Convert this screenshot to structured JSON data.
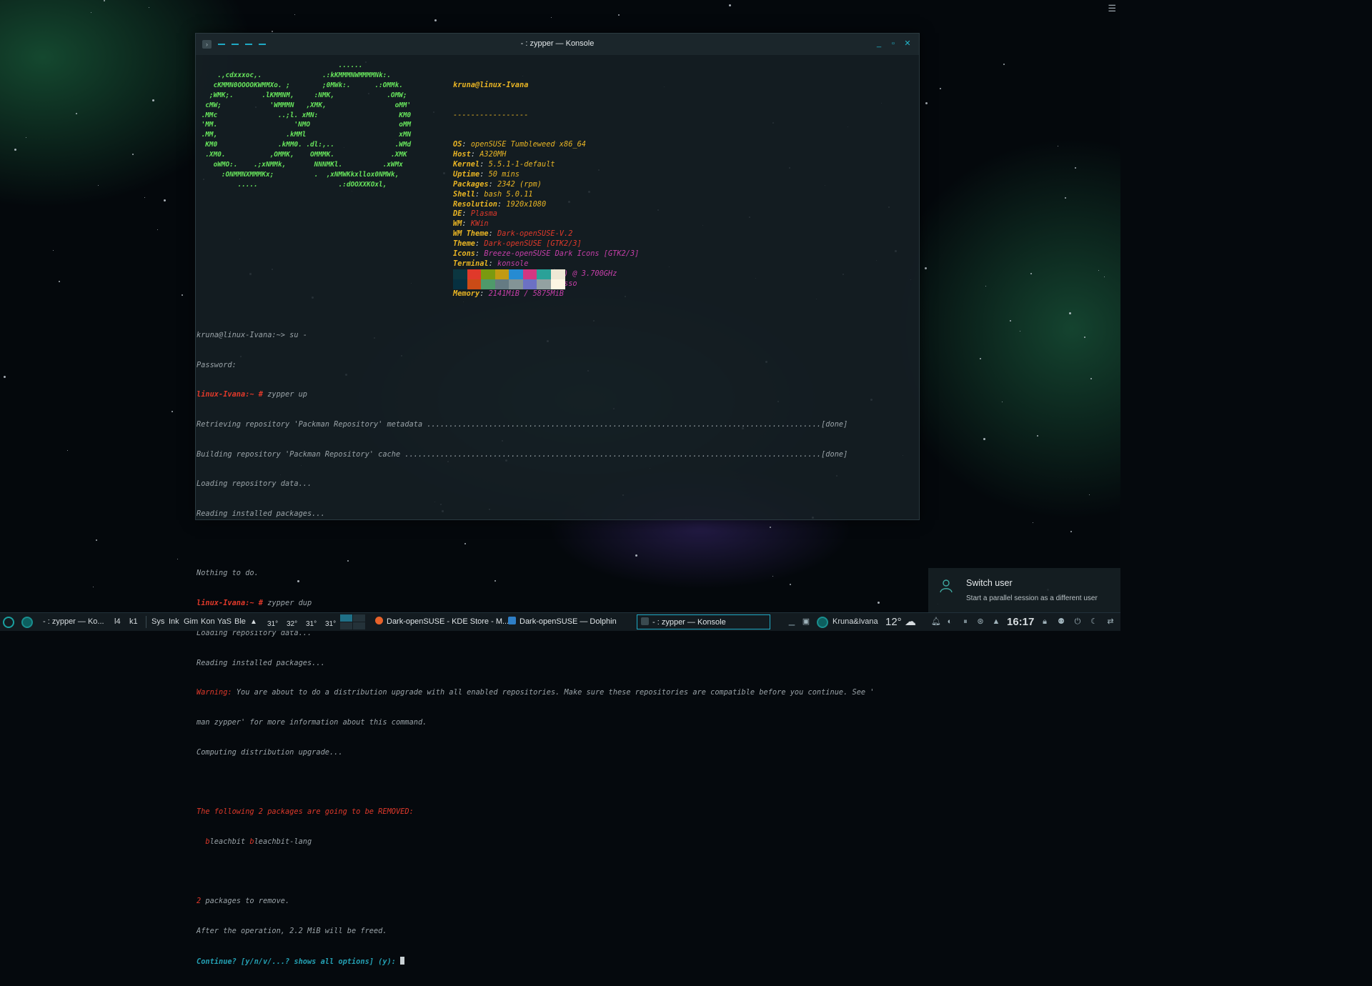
{
  "desktop": {
    "corner_menu_icon": "hamburger-icon"
  },
  "window": {
    "title": "- : zypper — Konsole",
    "buttons": {
      "minimize": "_",
      "maximize": "▫",
      "close": "✕"
    }
  },
  "neofetch": {
    "ascii_art": "                                   ......\n     .,cdxxxoc,.               .:kKMMMNWMMMMNk:.\n    cKMMN0OOOOKWMMXo. ;        ;0MWk:.      .:OMMk.\n   ;WMK;.       .lKMMNM,     :NMK,             .OMW;\n  cMW;            'WMMMN   ,XMK,                 oMM'\n .MMc               ..;l. xMN:                    KM0\n 'MM.                   'NMO                      oMM\n .MM,                 .kMMl                       xMN\n  KM0               .kMM0. .dl:,..               .WMd\n  .XM0.           ,OMMK,    OMMMK.              .XMK\n    oWMO:.    .;xNMMk,       NNNMKl.          .xWMx\n      :ONMMNXMMMKx;          .  ,xNMWKkxllox0NMWk,\n          .....                    .:dOOXXKOxl,",
    "user": "kruna@linux-Ivana",
    "separator": "-----------------",
    "info": [
      {
        "key": "OS",
        "value": "openSUSE Tumbleweed x86_64",
        "color": "#e8b424"
      },
      {
        "key": "Host",
        "value": "A320MH",
        "color": "#e8b424"
      },
      {
        "key": "Kernel",
        "value": "5.5.1-1-default",
        "color": "#e8b424"
      },
      {
        "key": "Uptime",
        "value": "50 mins",
        "color": "#e8b424"
      },
      {
        "key": "Packages",
        "value": "2342 (rpm)",
        "color": "#e8b424"
      },
      {
        "key": "Shell",
        "value": "bash 5.0.11",
        "color": "#e8b424"
      },
      {
        "key": "Resolution",
        "value": "1920x1080",
        "color": "#e8b424"
      },
      {
        "key": "DE",
        "value": "Plasma",
        "color": "#e0392a"
      },
      {
        "key": "WM",
        "value": "KWin",
        "color": "#e0392a"
      },
      {
        "key": "WM Theme",
        "value": "Dark-openSUSE-V.2",
        "color": "#e0392a"
      },
      {
        "key": "Theme",
        "value": "Dark-openSUSE [GTK2/3]",
        "color": "#e0392a"
      },
      {
        "key": "Icons",
        "value": "Breeze-openSUSE Dark Icons [GTK2/3]",
        "color": "#c53fa8"
      },
      {
        "key": "Terminal",
        "value": "konsole",
        "color": "#c53fa8"
      },
      {
        "key": "CPU",
        "value": "AMD Ryzen 5 3400G (8) @ 3.700GHz",
        "color": "#c53fa8"
      },
      {
        "key": "GPU",
        "value": "AMD ATI 07:00.0 Picasso",
        "color": "#c53fa8"
      },
      {
        "key": "Memory",
        "value": "2141MiB / 5875MiB",
        "color": "#c53fa8"
      }
    ],
    "palette_top": [
      "#0b3640",
      "#e0392a",
      "#7a9a10",
      "#c19a12",
      "#268bd2",
      "#d33682",
      "#2aa198",
      "#eee8d5"
    ],
    "palette_bottom": [
      "#063040",
      "#cb4b16",
      "#4f9a6a",
      "#657b83",
      "#839496",
      "#6c71c4",
      "#93a1a1",
      "#fdf6e3"
    ]
  },
  "terminal": {
    "line1": "kruna@linux-Ivana:~> su -",
    "line2": "Password:",
    "prompt1": "linux-Ivana:~ #",
    "cmd1": " zypper up",
    "line4": "Retrieving repository 'Packman Repository' metadata .........................................................................................[done]",
    "line5": "Building repository 'Packman Repository' cache ..............................................................................................[done]",
    "line6": "Loading repository data...",
    "line7": "Reading installed packages...",
    "line8": "",
    "line9": "Nothing to do.",
    "prompt2": "linux-Ivana:~ #",
    "cmd2": " zypper dup",
    "line11": "Loading repository data...",
    "line12": "Reading installed packages...",
    "warning_label": "Warning:",
    "warning_text": " You are about to do a distribution upgrade with all enabled repositories. Make sure these repositories are compatible before you continue. See '",
    "line14": "man zypper' for more information about this command.",
    "line15": "Computing distribution upgrade...",
    "removed_header": "The following 2 packages are going to be REMOVED:",
    "pkg1_initial": "b",
    "pkg1_rest": "leachbit ",
    "pkg2_initial": "b",
    "pkg2_rest": "leachbit-lang",
    "count_num": "2",
    "count_text": " packages to remove.",
    "line20": "After the operation, 2.2 MiB will be freed.",
    "continue_prompt": "Continue? [y/n/v/...? shows all options] (y): "
  },
  "notification": {
    "title": "Switch user",
    "subtitle": "Start a parallel session as a different user"
  },
  "taskbar": {
    "entry1": "- : zypper — Ko...",
    "quick1": "l4",
    "quick2": "k1",
    "quick3": "Sys",
    "quick4": "Ink",
    "quick5": "Gim",
    "quick6": "Kon",
    "quick7": "YaS",
    "quick8": "Ble",
    "temps": [
      "31°",
      "32°",
      "31°",
      "31°"
    ],
    "task_firefox": "Dark-openSUSE - KDE Store - M...",
    "task_dolphin": "Dark-openSUSE — Dolphin",
    "task_konsole": "- : zypper — Konsole",
    "user": "Kruna&Ivana",
    "weather_temp": "12°",
    "clock": "16:17"
  }
}
